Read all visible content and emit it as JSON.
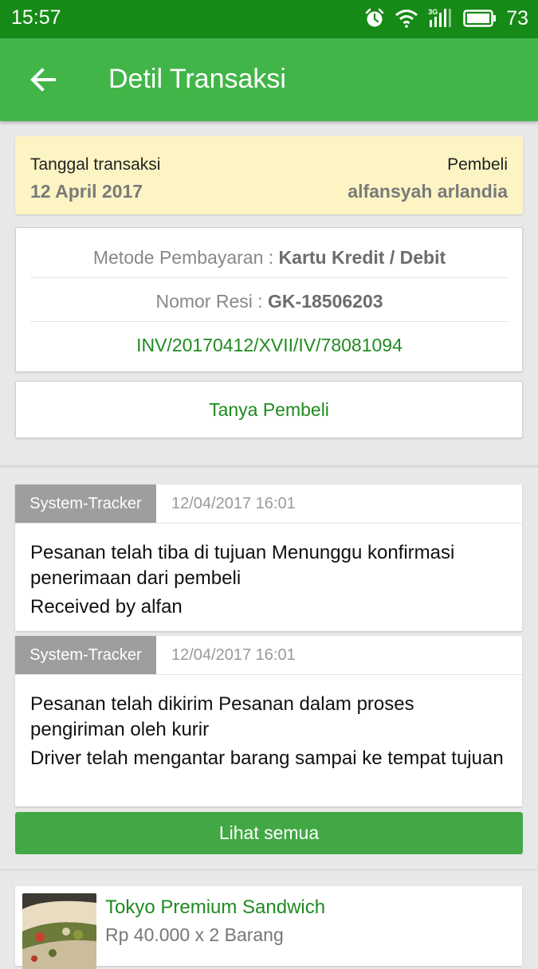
{
  "status": {
    "time": "15:57",
    "network": "3G",
    "battery": "73"
  },
  "appbar": {
    "title": "Detil Transaksi"
  },
  "transaction": {
    "date_label": "Tanggal transaksi",
    "date_value": "12 April 2017",
    "buyer_label": "Pembeli",
    "buyer_value": "alfansyah arlandia"
  },
  "payment": {
    "method_label": "Metode Pembayaran : ",
    "method_value": "Kartu Kredit / Debit",
    "receipt_label": "Nomor Resi : ",
    "receipt_value": "GK-18506203",
    "invoice": "INV/20170412/XVII/IV/78081094"
  },
  "ask_button": "Tanya Pembeli",
  "tracker": [
    {
      "source": "System-Tracker",
      "timestamp": "12/04/2017 16:01",
      "line1": "Pesanan telah tiba di tujuan Menunggu konfirmasi penerimaan dari pembeli",
      "line2": "Received by alfan"
    },
    {
      "source": "System-Tracker",
      "timestamp": "12/04/2017 16:01",
      "line1": "Pesanan telah dikirim Pesanan dalam proses pengiriman oleh kurir",
      "line2": "Driver telah mengantar barang sampai ke tempat tujuan"
    }
  ],
  "see_all_button": "Lihat semua",
  "product": {
    "name": "Tokyo Premium Sandwich",
    "price": "Rp 40.000 x 2 Barang"
  },
  "colors": {
    "primary": "#42b549",
    "status_bar": "#168a16",
    "date_bg": "#fdf4c4",
    "link_green": "#1f8b1f",
    "tag_grey": "#9e9e9e"
  },
  "icons": [
    "alarm-icon",
    "wifi-icon",
    "signal-icon",
    "battery-icon",
    "back-arrow-icon"
  ]
}
